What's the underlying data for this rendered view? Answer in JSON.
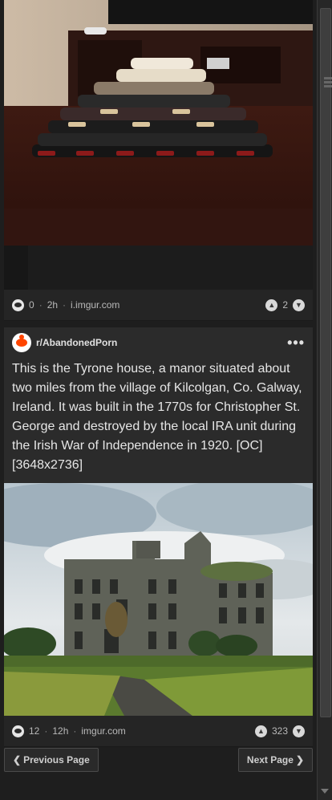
{
  "posts": [
    {
      "image_alt": "Stacked snus tins on a wooden table",
      "comments": "0",
      "age": "2h",
      "domain": "i.imgur.com",
      "score": "2"
    },
    {
      "subreddit": "r/AbandonedPorn",
      "title": "This is the Tyrone house, a manor situated about two miles from the village of Kilcolgan, Co. Galway, Ireland. It was built in the 1770s for Christopher St. George and destroyed by the local IRA unit during the Irish War of Independence in 1920. [OC] [3648x2736]",
      "image_alt": "Ruined manor house overgrown with ivy",
      "comments": "12",
      "age": "12h",
      "domain": "imgur.com",
      "score": "323"
    }
  ],
  "pagination": {
    "previous_label": "Previous Page",
    "next_label": "Next Page"
  },
  "icons": {
    "comment": "comment-icon",
    "upvote": "upvote-icon",
    "downvote": "downvote-icon",
    "more": "more-icon",
    "prev": "chevron-left-icon",
    "next": "chevron-right-icon"
  }
}
